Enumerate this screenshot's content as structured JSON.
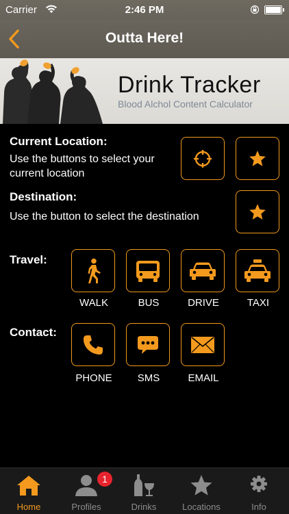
{
  "status_bar": {
    "carrier": "Carrier",
    "time": "2:46 PM"
  },
  "nav": {
    "title": "Outta Here!"
  },
  "banner": {
    "title": "Drink Tracker",
    "subtitle": "Blood Alchol Content Calculator"
  },
  "current_location": {
    "label": "Current Location:",
    "description": "Use the buttons to select your current location"
  },
  "destination": {
    "label": "Destination:",
    "description": "Use the button to select the destination"
  },
  "travel": {
    "label": "Travel:",
    "options": [
      "WALK",
      "BUS",
      "DRIVE",
      "TAXI"
    ]
  },
  "contact": {
    "label": "Contact:",
    "options": [
      "PHONE",
      "SMS",
      "EMAIL"
    ]
  },
  "tabs": [
    {
      "label": "Home",
      "icon": "home-icon",
      "active": true
    },
    {
      "label": "Profiles",
      "icon": "profile-icon",
      "badge": "1"
    },
    {
      "label": "Drinks",
      "icon": "drinks-icon"
    },
    {
      "label": "Locations",
      "icon": "star-icon"
    },
    {
      "label": "Info",
      "icon": "gear-icon"
    }
  ],
  "colors": {
    "accent": "#f39a1e",
    "background": "#000000",
    "navbar": "#625d55",
    "tabbar": "#1a1a1a",
    "badge": "#e8232d"
  }
}
